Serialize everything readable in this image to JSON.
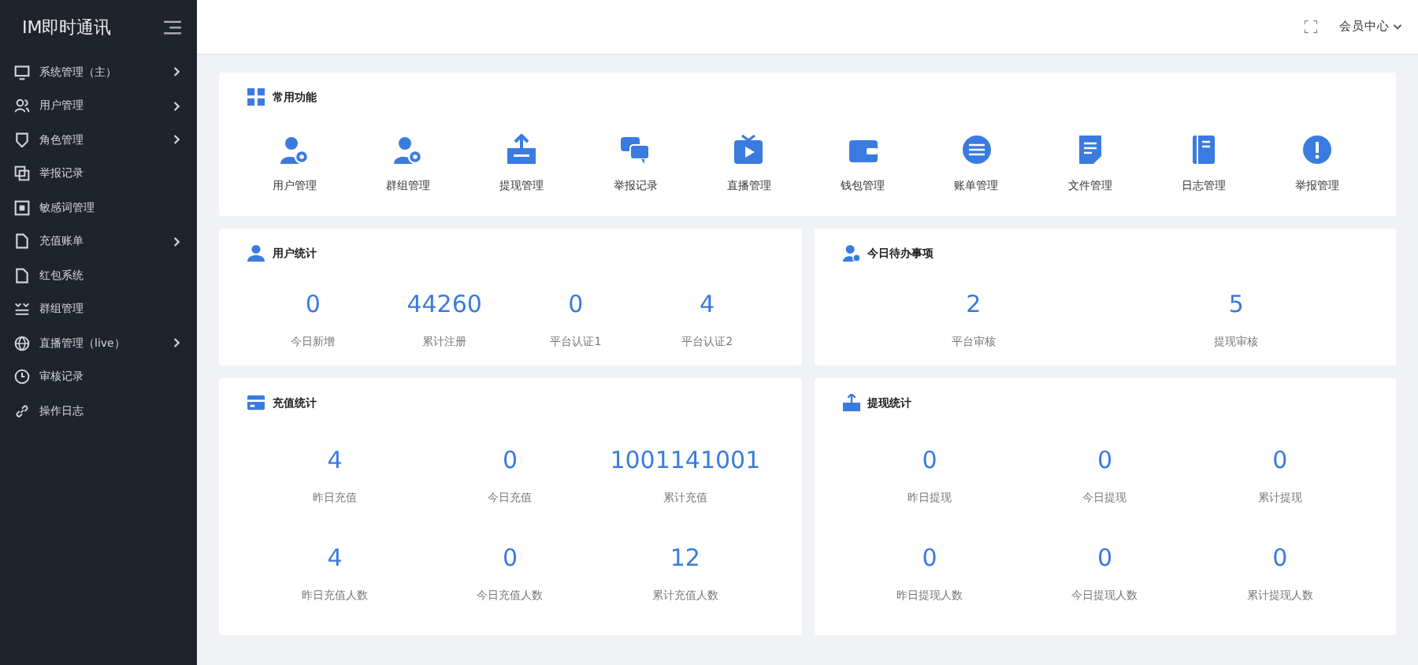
{
  "sidebar": {
    "title": "IM即时通讯",
    "items": [
      {
        "label": "系统管理（主）",
        "has_submenu": true
      },
      {
        "label": "用户管理",
        "has_submenu": true
      },
      {
        "label": "角色管理",
        "has_submenu": true
      },
      {
        "label": "举报记录",
        "has_submenu": false
      },
      {
        "label": "敏感词管理",
        "has_submenu": false
      },
      {
        "label": "充值账单",
        "has_submenu": true
      },
      {
        "label": "红包系统",
        "has_submenu": false
      },
      {
        "label": "群组管理",
        "has_submenu": false
      },
      {
        "label": "直播管理（live）",
        "has_submenu": true
      },
      {
        "label": "审核记录",
        "has_submenu": false
      },
      {
        "label": "操作日志",
        "has_submenu": false
      }
    ]
  },
  "header": {
    "user_menu": "会员中心"
  },
  "shortcuts": {
    "title": "常用功能",
    "items": [
      {
        "label": "用户管理"
      },
      {
        "label": "群组管理"
      },
      {
        "label": "提现管理"
      },
      {
        "label": "举报记录"
      },
      {
        "label": "直播管理"
      },
      {
        "label": "钱包管理"
      },
      {
        "label": "账单管理"
      },
      {
        "label": "文件管理"
      },
      {
        "label": "日志管理"
      },
      {
        "label": "举报管理"
      }
    ]
  },
  "user_stats": {
    "title": "用户统计",
    "stats": [
      {
        "value": "0",
        "label": "今日新增"
      },
      {
        "value": "44260",
        "label": "累计注册"
      },
      {
        "value": "0",
        "label": "平台认证1"
      },
      {
        "value": "4",
        "label": "平台认证2"
      }
    ]
  },
  "todo": {
    "title": "今日待办事项",
    "stats": [
      {
        "value": "2",
        "label": "平台审核"
      },
      {
        "value": "5",
        "label": "提现审核"
      }
    ]
  },
  "recharge": {
    "title": "充值统计",
    "stats": [
      {
        "value": "4",
        "label": "昨日充值"
      },
      {
        "value": "0",
        "label": "今日充值"
      },
      {
        "value": "1001141001",
        "label": "累计充值"
      },
      {
        "value": "4",
        "label": "昨日充值人数"
      },
      {
        "value": "0",
        "label": "今日充值人数"
      },
      {
        "value": "12",
        "label": "累计充值人数"
      }
    ]
  },
  "withdraw": {
    "title": "提现统计",
    "stats": [
      {
        "value": "0",
        "label": "昨日提现"
      },
      {
        "value": "0",
        "label": "今日提现"
      },
      {
        "value": "0",
        "label": "累计提现"
      },
      {
        "value": "0",
        "label": "昨日提现人数"
      },
      {
        "value": "0",
        "label": "今日提现人数"
      },
      {
        "value": "0",
        "label": "累计提现人数"
      }
    ]
  }
}
